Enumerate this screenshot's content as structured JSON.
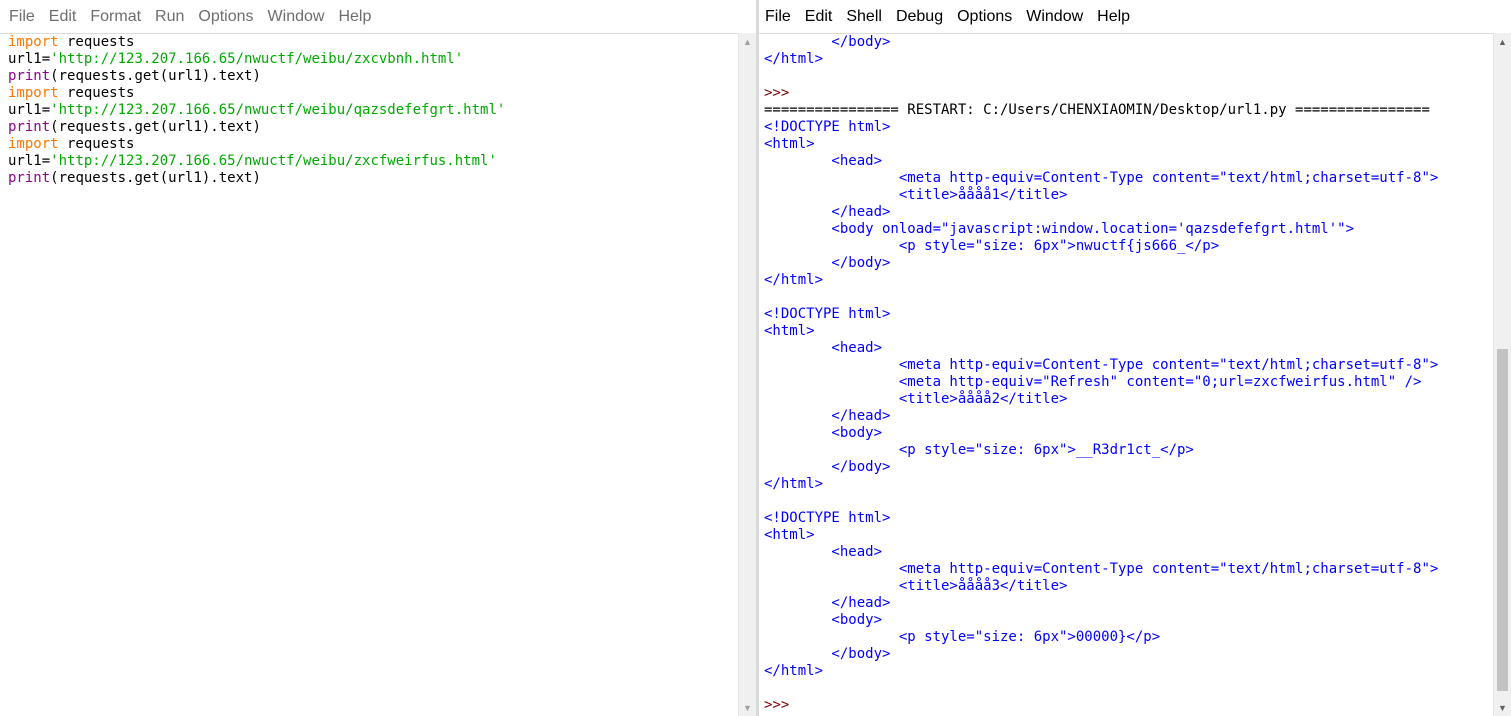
{
  "left_window": {
    "menu": [
      "File",
      "Edit",
      "Format",
      "Run",
      "Options",
      "Window",
      "Help"
    ],
    "code_lines": [
      [
        {
          "t": "import",
          "c": "kw"
        },
        {
          "t": " requests",
          "c": "plain"
        }
      ],
      [
        {
          "t": "url1=",
          "c": "plain"
        },
        {
          "t": "'http://123.207.166.65/nwuctf/weibu/zxcvbnh.html'",
          "c": "str"
        }
      ],
      [
        {
          "t": "print",
          "c": "bi"
        },
        {
          "t": "(requests.get(url1).text)",
          "c": "plain"
        }
      ],
      [
        {
          "t": "import",
          "c": "kw"
        },
        {
          "t": " requests",
          "c": "plain"
        }
      ],
      [
        {
          "t": "url1=",
          "c": "plain"
        },
        {
          "t": "'http://123.207.166.65/nwuctf/weibu/qazsdefefgrt.html'",
          "c": "str"
        }
      ],
      [
        {
          "t": "print",
          "c": "bi"
        },
        {
          "t": "(requests.get(url1).text)",
          "c": "plain"
        }
      ],
      [
        {
          "t": "import",
          "c": "kw"
        },
        {
          "t": " requests",
          "c": "plain"
        }
      ],
      [
        {
          "t": "url1=",
          "c": "plain"
        },
        {
          "t": "'http://123.207.166.65/nwuctf/weibu/zxcfweirfus.html'",
          "c": "str"
        }
      ],
      [
        {
          "t": "print",
          "c": "bi"
        },
        {
          "t": "(requests.get(url1).text)",
          "c": "plain"
        }
      ]
    ]
  },
  "right_window": {
    "menu": [
      "File",
      "Edit",
      "Shell",
      "Debug",
      "Options",
      "Window",
      "Help"
    ],
    "shell_lines": [
      [
        {
          "t": "        </body>",
          "c": "out"
        }
      ],
      [
        {
          "t": "</html>",
          "c": "out"
        }
      ],
      [
        {
          "t": "",
          "c": "out"
        }
      ],
      [
        {
          "t": ">>> ",
          "c": "prompt"
        }
      ],
      [
        {
          "t": "================ RESTART: C:/Users/CHENXIAOMIN/Desktop/url1.py ================",
          "c": "plain"
        }
      ],
      [
        {
          "t": "<!DOCTYPE html>",
          "c": "out"
        }
      ],
      [
        {
          "t": "<html>",
          "c": "out"
        }
      ],
      [
        {
          "t": "        <head>",
          "c": "out"
        }
      ],
      [
        {
          "t": "                <meta http-equiv=Content-Type content=\"text/html;charset=utf-8\">",
          "c": "out"
        }
      ],
      [
        {
          "t": "                <title>åååå1</title>",
          "c": "out"
        }
      ],
      [
        {
          "t": "        </head>",
          "c": "out"
        }
      ],
      [
        {
          "t": "        <body onload=\"javascript:window.location='qazsdefefgrt.html'\">",
          "c": "out"
        }
      ],
      [
        {
          "t": "                <p style=\"size: 6px\">nwuctf{js666_</p>",
          "c": "out"
        }
      ],
      [
        {
          "t": "        </body>",
          "c": "out"
        }
      ],
      [
        {
          "t": "</html>",
          "c": "out"
        }
      ],
      [
        {
          "t": "",
          "c": "out"
        }
      ],
      [
        {
          "t": "<!DOCTYPE html>",
          "c": "out"
        }
      ],
      [
        {
          "t": "<html>",
          "c": "out"
        }
      ],
      [
        {
          "t": "        <head>",
          "c": "out"
        }
      ],
      [
        {
          "t": "                <meta http-equiv=Content-Type content=\"text/html;charset=utf-8\">",
          "c": "out"
        }
      ],
      [
        {
          "t": "                <meta http-equiv=\"Refresh\" content=\"0;url=zxcfweirfus.html\" />",
          "c": "out"
        }
      ],
      [
        {
          "t": "                <title>åååå2</title>",
          "c": "out"
        }
      ],
      [
        {
          "t": "        </head>",
          "c": "out"
        }
      ],
      [
        {
          "t": "        <body>",
          "c": "out"
        }
      ],
      [
        {
          "t": "                <p style=\"size: 6px\">__R3dr1ct_</p>",
          "c": "out"
        }
      ],
      [
        {
          "t": "        </body>",
          "c": "out"
        }
      ],
      [
        {
          "t": "</html>",
          "c": "out"
        }
      ],
      [
        {
          "t": "",
          "c": "out"
        }
      ],
      [
        {
          "t": "<!DOCTYPE html>",
          "c": "out"
        }
      ],
      [
        {
          "t": "<html>",
          "c": "out"
        }
      ],
      [
        {
          "t": "        <head>",
          "c": "out"
        }
      ],
      [
        {
          "t": "                <meta http-equiv=Content-Type content=\"text/html;charset=utf-8\">",
          "c": "out"
        }
      ],
      [
        {
          "t": "                <title>åååå3</title>",
          "c": "out"
        }
      ],
      [
        {
          "t": "        </head>",
          "c": "out"
        }
      ],
      [
        {
          "t": "        <body>",
          "c": "out"
        }
      ],
      [
        {
          "t": "                <p style=\"size: 6px\">00000}</p>",
          "c": "out"
        }
      ],
      [
        {
          "t": "        </body>",
          "c": "out"
        }
      ],
      [
        {
          "t": "</html>",
          "c": "out"
        }
      ],
      [
        {
          "t": "",
          "c": "out"
        }
      ],
      [
        {
          "t": ">>> ",
          "c": "prompt"
        }
      ]
    ],
    "scroll_position": 0.48
  },
  "icons": {
    "scroll_up": "▲",
    "scroll_down": "▼"
  }
}
